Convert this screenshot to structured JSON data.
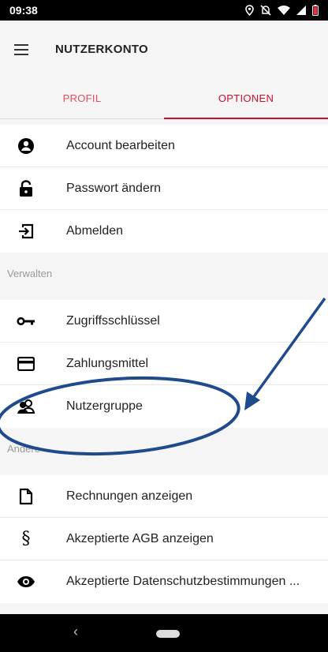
{
  "status_bar": {
    "time": "09:38",
    "icons": [
      "location-icon",
      "mute-icon",
      "wifi-icon",
      "signal-icon",
      "battery-icon"
    ]
  },
  "app_bar": {
    "title": "NUTZERKONTO",
    "menu_icon": "hamburger-menu-icon"
  },
  "tabs": [
    {
      "label": "PROFIL",
      "active": false
    },
    {
      "label": "OPTIONEN",
      "active": true
    }
  ],
  "colors": {
    "accent": "#c8102e",
    "annotation": "#1f4a8c"
  },
  "account_items": [
    {
      "label": "Account bearbeiten",
      "icon": "account-circle-icon"
    },
    {
      "label": "Passwort ändern",
      "icon": "lock-icon"
    },
    {
      "label": "Abmelden",
      "icon": "logout-icon"
    }
  ],
  "sections": [
    {
      "header": "Verwalten",
      "items": [
        {
          "label": "Zugriffsschlüssel",
          "icon": "key-icon"
        },
        {
          "label": "Zahlungsmittel",
          "icon": "credit-card-icon"
        },
        {
          "label": "Nutzergruppe",
          "icon": "group-icon"
        }
      ]
    },
    {
      "header": "Andere",
      "items": [
        {
          "label": "Rechnungen anzeigen",
          "icon": "document-icon"
        },
        {
          "label": "Akzeptierte AGB anzeigen",
          "icon": "paragraph-icon"
        },
        {
          "label": "Akzeptierte Datenschutzbestimmungen ...",
          "icon": "eye-icon"
        }
      ]
    }
  ],
  "nav_bar": {
    "back_icon": "back-icon",
    "home_icon": "home-pill-icon"
  }
}
